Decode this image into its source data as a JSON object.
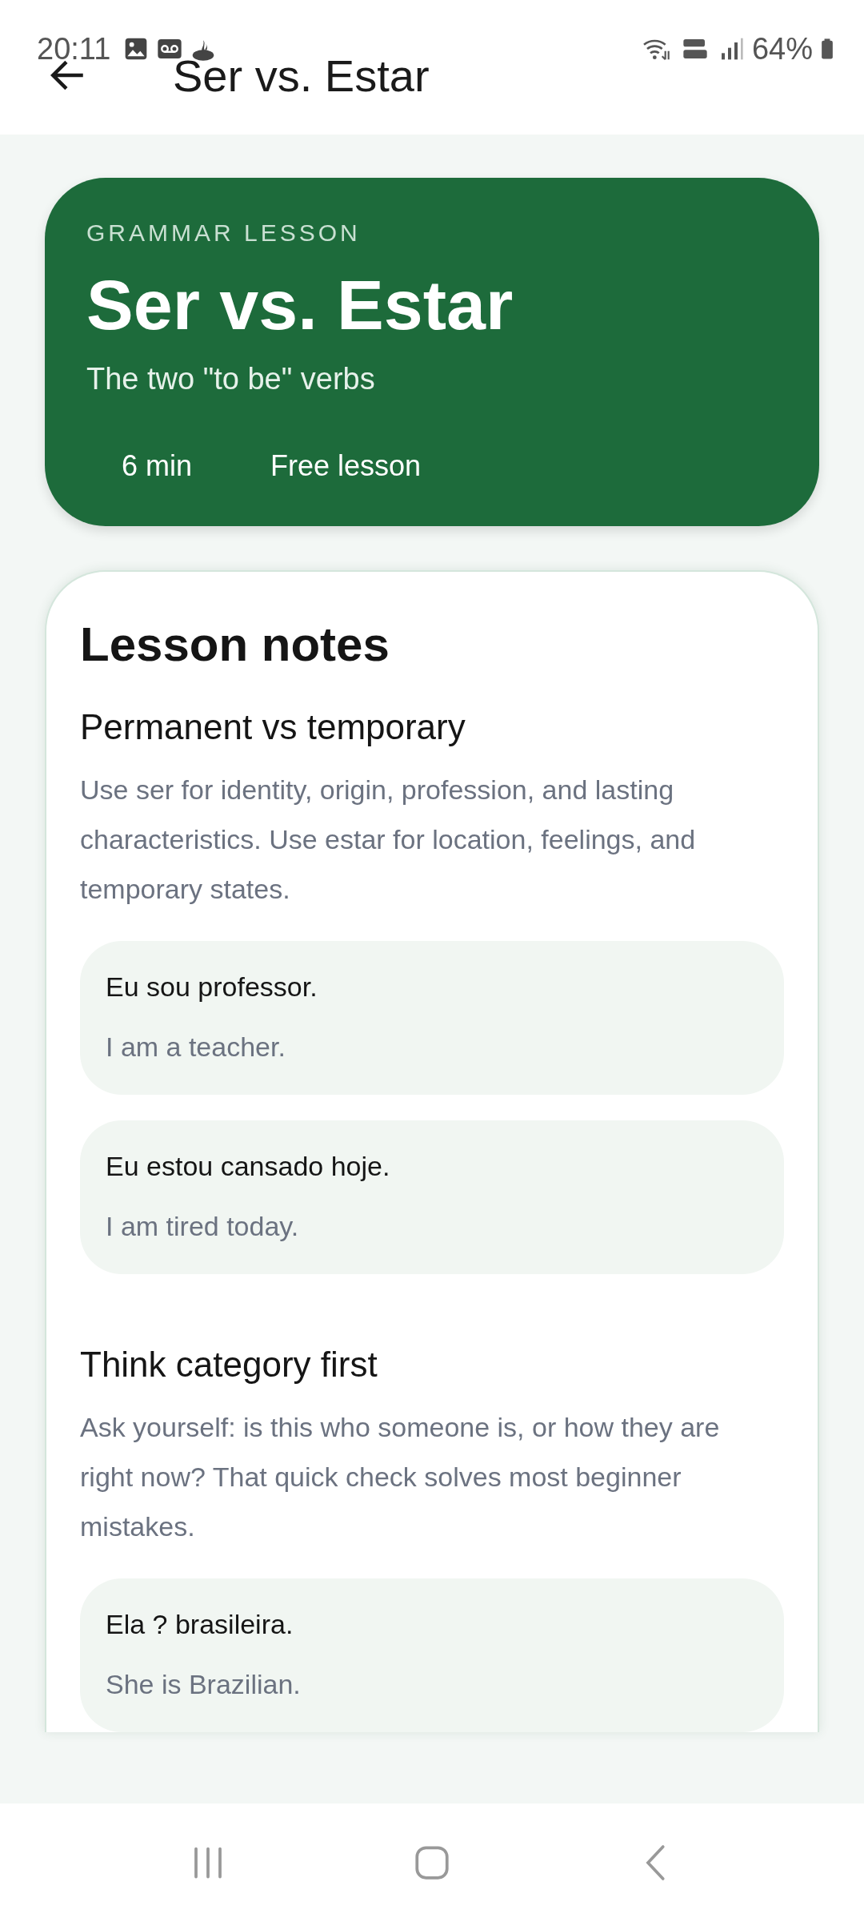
{
  "status_bar": {
    "time": "20:11",
    "battery": "64%"
  },
  "app_bar": {
    "title": "Ser vs. Estar"
  },
  "hero": {
    "eyebrow": "GRAMMAR LESSON",
    "title": "Ser vs. Estar",
    "subtitle": "The two \"to be\" verbs",
    "meta": [
      "6 min",
      "Free lesson"
    ]
  },
  "notes": {
    "title": "Lesson notes",
    "sections": [
      {
        "heading": "Permanent vs temporary",
        "body": "Use ser for identity, origin, profession, and lasting characteristics. Use estar for location, feelings, and temporary states.",
        "examples": [
          {
            "phrase": "Eu sou professor.",
            "translation": "I am a teacher."
          },
          {
            "phrase": "Eu estou cansado hoje.",
            "translation": "I am tired today."
          }
        ]
      },
      {
        "heading": "Think category first",
        "body": "Ask yourself: is this who someone is, or how they are right now? That quick check solves most beginner mistakes.",
        "examples": [
          {
            "phrase": "Ela ? brasileira.",
            "translation": "She is Brazilian."
          }
        ]
      }
    ]
  }
}
